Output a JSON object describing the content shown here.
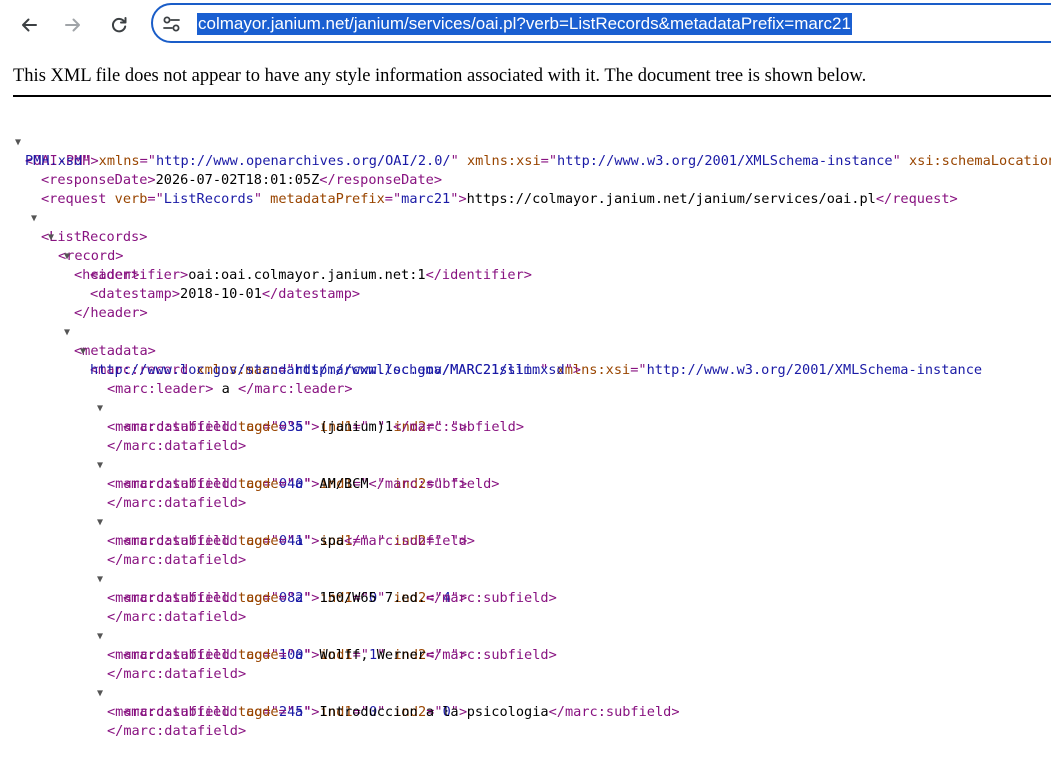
{
  "browser": {
    "back_icon": "arrow-left-icon",
    "forward_icon": "arrow-right-icon",
    "reload_icon": "reload-icon",
    "site_info_icon": "tune-icon",
    "url": "colmayor.janium.net/janium/services/oai.pl?verb=ListRecords&metadataPrefix=marc21",
    "accent_color": "#1a5dc8"
  },
  "info_message": "This XML file does not appear to have any style information associated with it. The document tree is shown below.",
  "xml": {
    "l1": {
      "t1": "<OAI-PMH",
      "a1": " xmlns",
      "p1": "=\"",
      "v1": "http://www.openarchives.org/OAI/2.0/",
      "q1": "\"",
      "a2": " xmlns:xsi",
      "p2": "=\"",
      "v2": "http://www.w3.org/2001/XMLSchema-instance",
      "q2": "\"",
      "a3": " xsi:schemaLocation"
    },
    "l2": {
      "v1": "PMH.xsd",
      "p1": "\"",
      "t1": ">"
    },
    "l3": {
      "t1": "<responseDate>",
      "x1": "2026-07-02T18:01:05Z",
      "t2": "</responseDate>"
    },
    "l4": {
      "t1": "<request",
      "a1": " verb",
      "p1": "=\"",
      "v1": "ListRecords",
      "q1": "\"",
      "a2": " metadataPrefix",
      "p2": "=\"",
      "v2": "marc21",
      "q2": "\"",
      "t2": ">",
      "x1": "https://colmayor.janium.net/janium/services/oai.pl",
      "t3": "</request>"
    },
    "l5": {
      "t1": "<ListRecords>"
    },
    "l6": {
      "t1": "<record>"
    },
    "l7": {
      "t1": "<header>"
    },
    "l8": {
      "t1": "<identifier>",
      "x1": "oai:oai.colmayor.janium.net:1",
      "t2": "</identifier>"
    },
    "l9": {
      "t1": "<datestamp>",
      "x1": "2018-10-01",
      "t2": "</datestamp>"
    },
    "l10": {
      "t1": "</header>"
    },
    "l11": {
      "t1": "<metadata>"
    },
    "l12": {
      "t1": "<marc:record",
      "a1": " xmlns:marc",
      "p1": "=\"",
      "v1": "http://www.loc.gov/MARC21/slim",
      "q1": "\"",
      "a2": " xmlns:xsi",
      "p2": "=\"",
      "v2": "http://www.w3.org/2001/XMLSchema-instance"
    },
    "l13": {
      "v1": "http://www.loc.gov/standards/marcxml/schema/MARC21slim.xsd",
      "p1": "\"",
      "t1": ">"
    },
    "l14": {
      "t1": "<marc:leader>",
      "x1": " a ",
      "t2": "</marc:leader>"
    },
    "df035": {
      "tag": "035",
      "ind1": " ",
      "ind2": " ",
      "code": "a",
      "value": "(janium)1"
    },
    "df040": {
      "tag": "040",
      "ind1": " ",
      "ind2": " ",
      "code": "a",
      "value": "AM/BCM"
    },
    "df041": {
      "tag": "041",
      "ind1": " ",
      "ind2": " ",
      "code": "a",
      "value": "spa"
    },
    "df082": {
      "tag": "082",
      "ind1": "0",
      "ind2": "4",
      "code": "a",
      "value": "150/W65 7.ed."
    },
    "df100": {
      "tag": "100",
      "ind1": "1",
      "ind2": " ",
      "code": "a",
      "value": "Wolff, Werner"
    },
    "df245": {
      "tag": "245",
      "ind1": "0",
      "ind2": "0",
      "code": "a",
      "value": "Introduccion a la psicologia"
    },
    "markup": {
      "df_open": "<marc:datafield",
      "df_close": "</marc:datafield>",
      "sf_open": "<marc:subfield",
      "sf_close": "</marc:subfield>",
      "tag_attr": " tag",
      "ind1_attr": " ind1",
      "ind2_attr": " ind2",
      "code_attr": " code",
      "eq_q": "=\"",
      "q": "\"",
      "gt": ">"
    },
    "toggle_expanded": "▼"
  }
}
